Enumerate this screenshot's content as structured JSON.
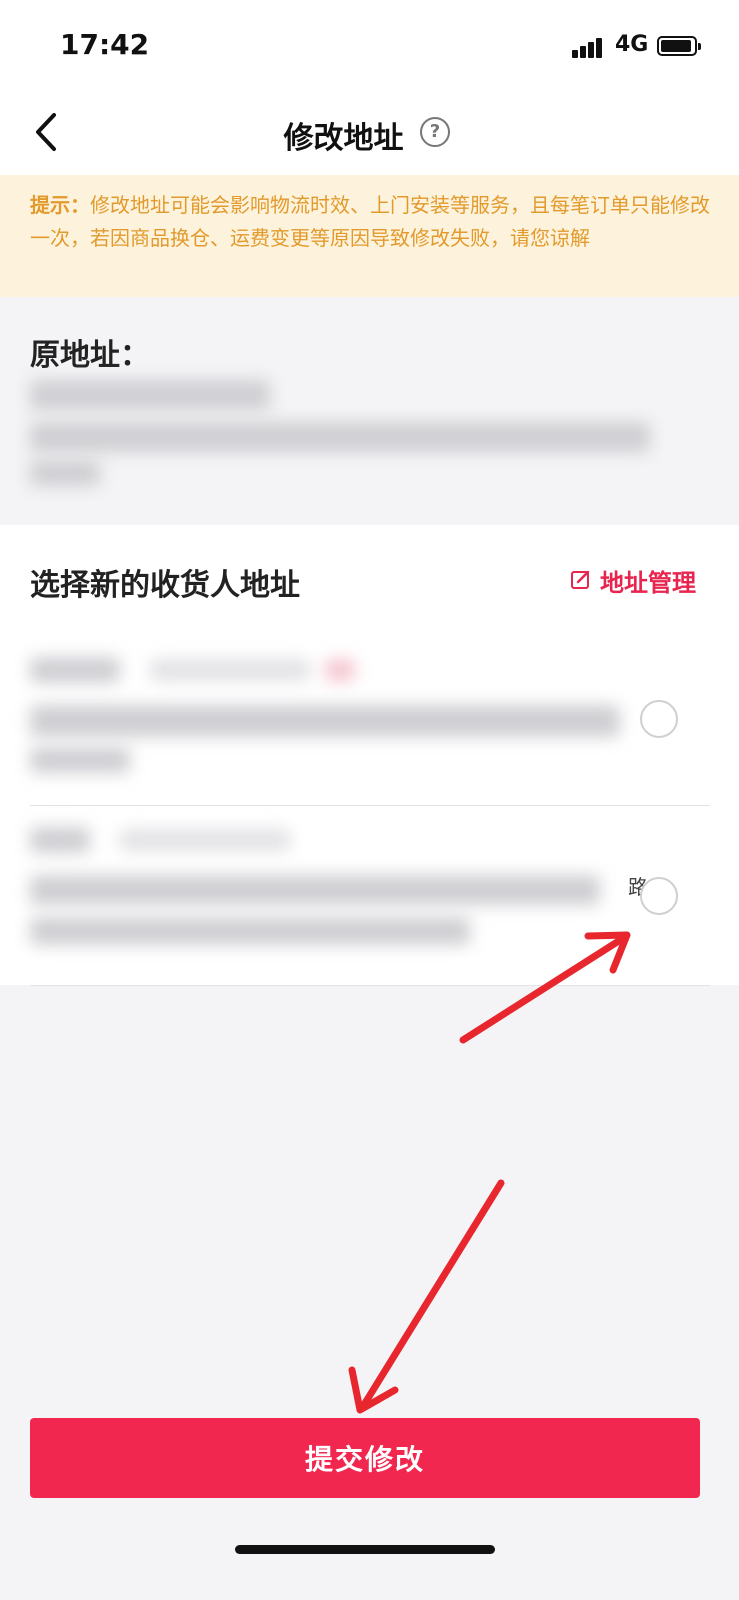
{
  "status_bar": {
    "time": "17:42",
    "network": "4G"
  },
  "header": {
    "title": "修改地址",
    "help_icon": "question-circle-icon",
    "help_glyph": "?"
  },
  "notice": {
    "prefix": "提示：",
    "text": "修改地址可能会影响物流时效、上门安装等服务，且每笔订单只能修改一次，若因商品换仓、运费变更等原因导致修改失败，请您谅解"
  },
  "original_address": {
    "label": "原地址："
  },
  "new_address": {
    "title": "选择新的收货人地址",
    "manage_label": "地址管理",
    "addresses": [
      {
        "selected": false,
        "visible_fragment": ""
      },
      {
        "selected": false,
        "visible_fragment": "路"
      }
    ]
  },
  "submit": {
    "label": "提交修改"
  },
  "colors": {
    "accent": "#f2274f",
    "notice_text": "#e39a2c",
    "notice_bg": "#fdf3dc",
    "annotation_arrow": "#e8262e"
  }
}
